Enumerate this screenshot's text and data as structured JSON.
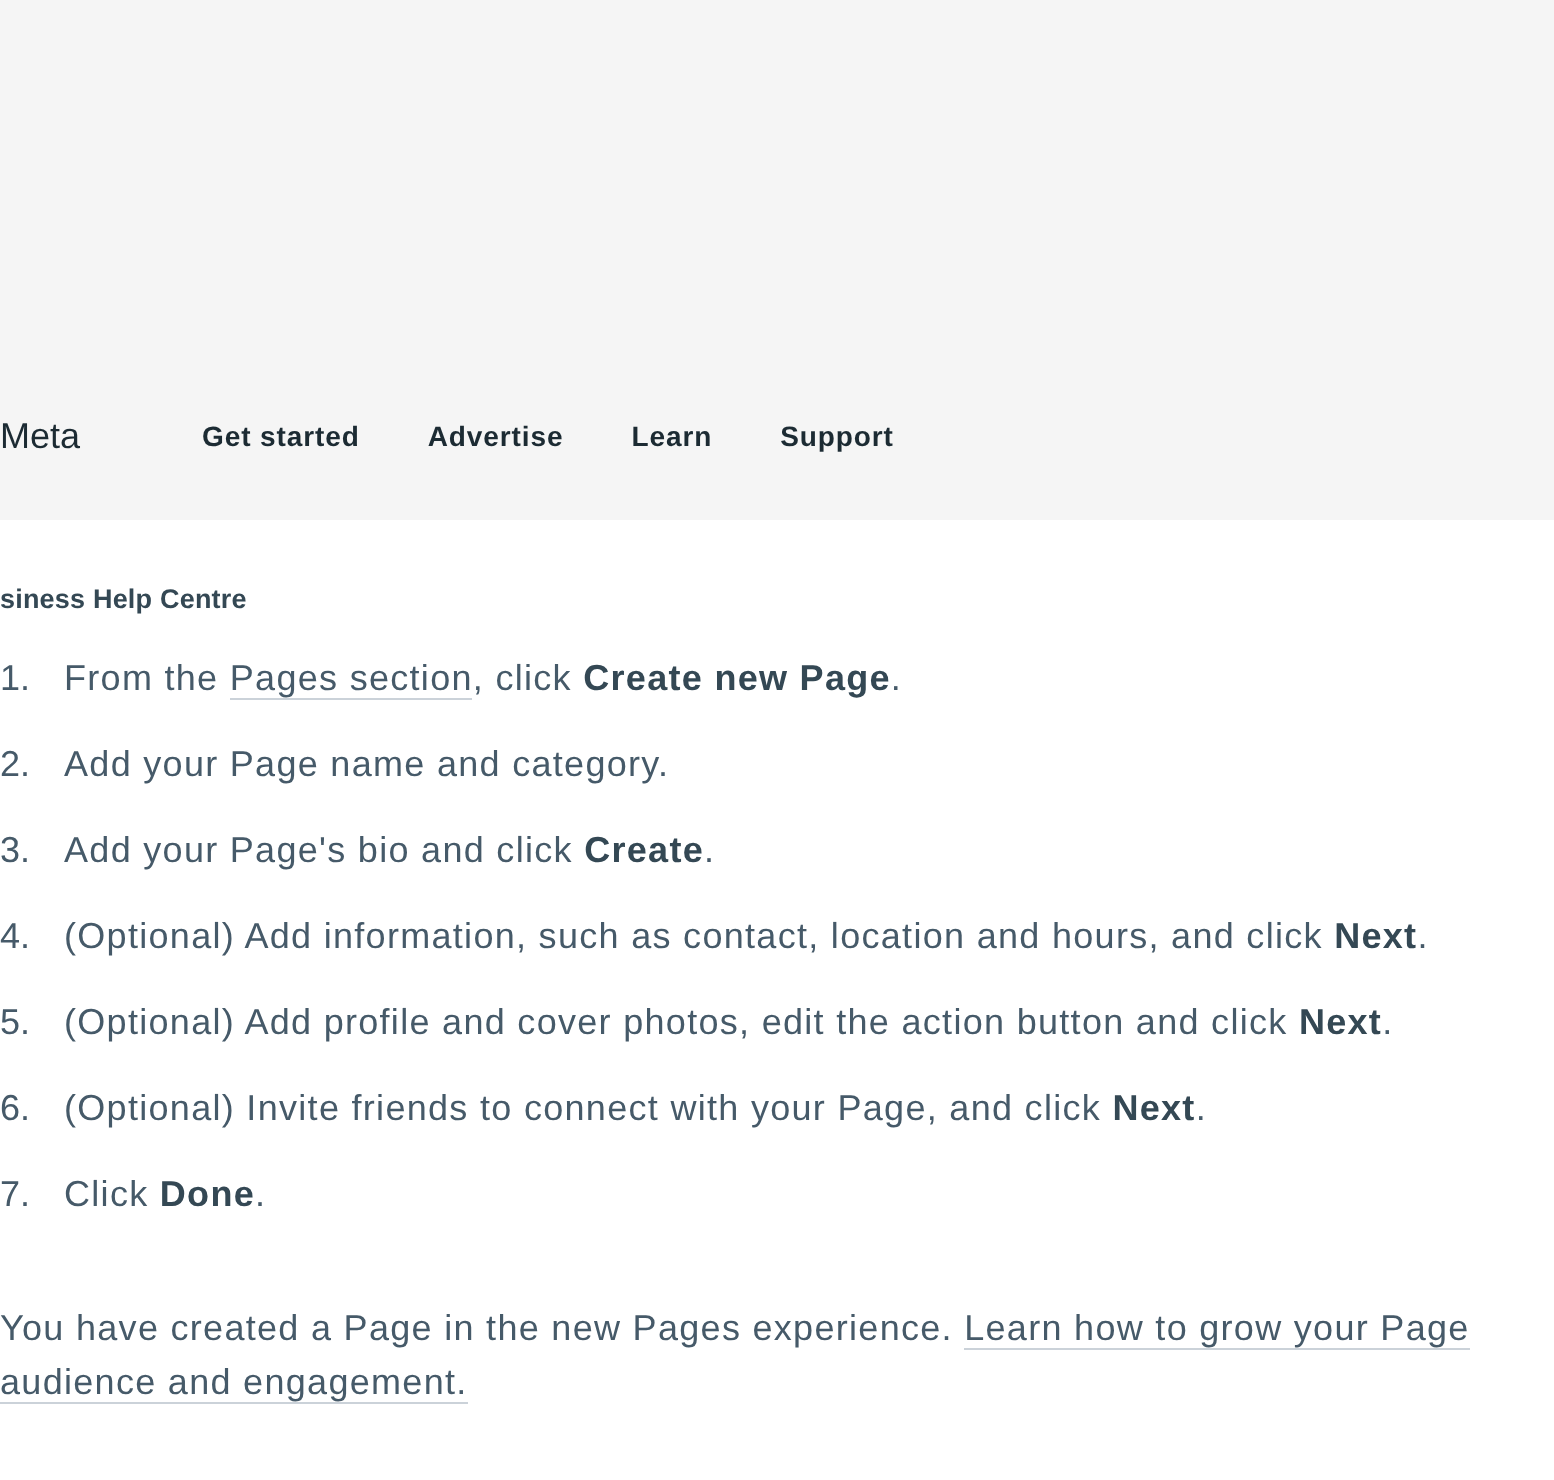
{
  "header": {
    "logo": "Meta",
    "nav": [
      {
        "label": "Get started"
      },
      {
        "label": "Advertise"
      },
      {
        "label": "Learn"
      },
      {
        "label": "Support"
      }
    ]
  },
  "breadcrumb": "siness Help Centre",
  "steps": [
    {
      "number": "1.",
      "parts": [
        {
          "kind": "text",
          "text": "From the "
        },
        {
          "kind": "link",
          "lines": [
            "Pages section"
          ]
        },
        {
          "kind": "text",
          "text": ", click **Create new Page**."
        }
      ]
    },
    {
      "number": "2.",
      "parts": [
        {
          "kind": "text",
          "text": "Add your Page name and category."
        }
      ]
    },
    {
      "number": "3.",
      "parts": [
        {
          "kind": "text",
          "text": "Add your Page's bio and click **Create**."
        }
      ]
    },
    {
      "number": "4.",
      "parts": [
        {
          "kind": "text",
          "text": "(Optional) Add information, such as contact, location and hours, and click **Next**."
        }
      ]
    },
    {
      "number": "5.",
      "parts": [
        {
          "kind": "text",
          "text": "(Optional) Add profile and cover photos, edit the action button and click **Next**."
        }
      ]
    },
    {
      "number": "6.",
      "parts": [
        {
          "kind": "text",
          "text": "(Optional) Invite friends to connect with your Page, and click **Next**."
        }
      ]
    },
    {
      "number": "7.",
      "parts": [
        {
          "kind": "text",
          "text": "Click **Done**."
        }
      ]
    }
  ],
  "note": {
    "parts": [
      {
        "kind": "text",
        "text": "You have created a Page in the new Pages experience. "
      },
      {
        "kind": "link",
        "lines": [
          "Learn how to grow your Page",
          "audience and engagement."
        ]
      }
    ]
  }
}
